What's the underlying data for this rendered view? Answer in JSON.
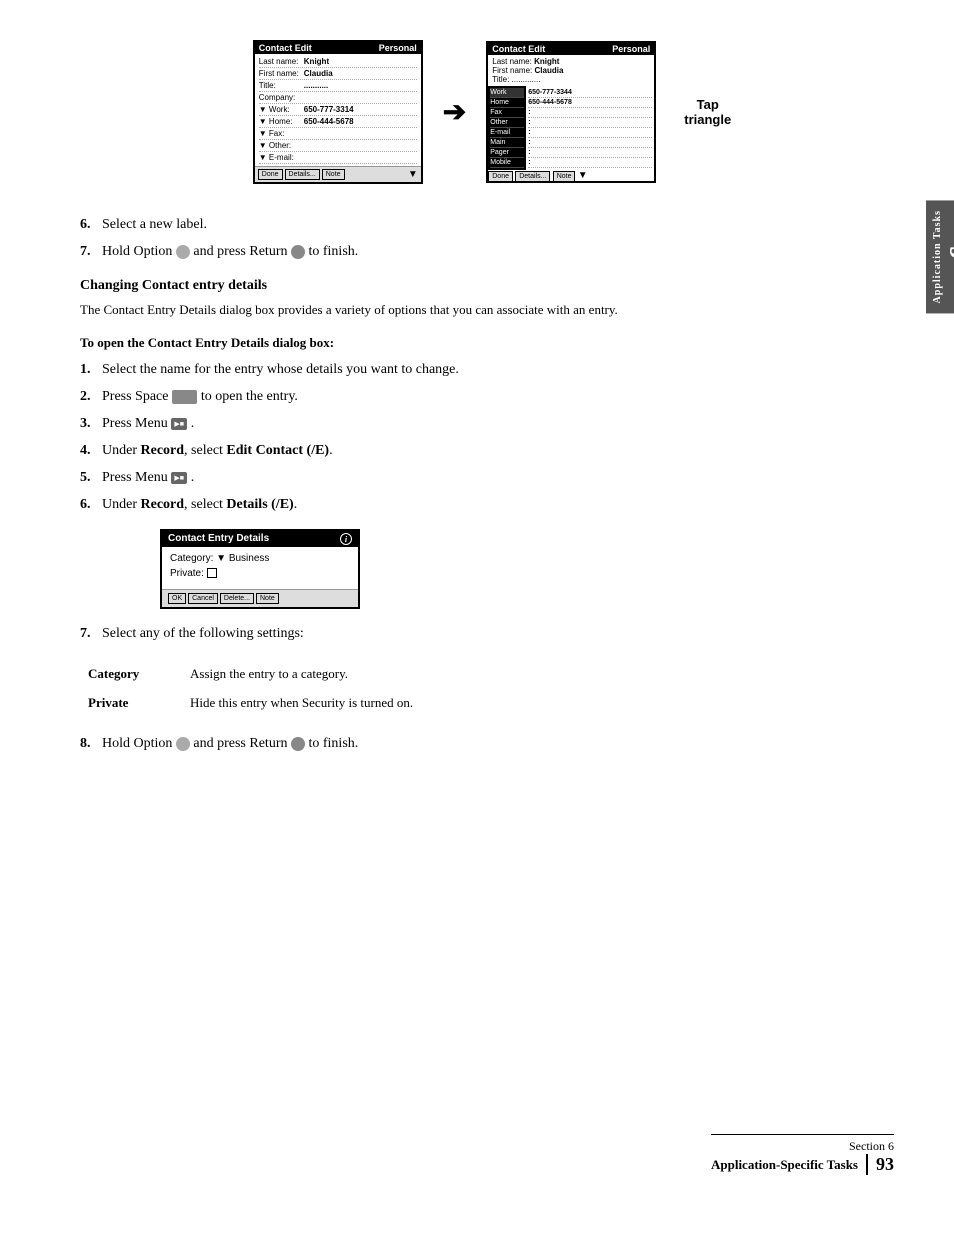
{
  "page": {
    "section_number": "6",
    "section_title": "Application Tasks",
    "sidebar_label": "Application Tasks"
  },
  "screen1": {
    "title": "Contact Edit",
    "tab": "Personal",
    "fields": [
      {
        "label": "Last name:",
        "value": "Knight",
        "bold": true
      },
      {
        "label": "First name:",
        "value": "Claudia",
        "bold": true
      },
      {
        "label": "Title:",
        "value": ""
      },
      {
        "label": "Company:",
        "value": ""
      },
      {
        "label": "▼ Work:",
        "value": "650-777-3314",
        "bold": true
      },
      {
        "label": "▼ Home:",
        "value": "650-444-5678",
        "bold": true
      },
      {
        "label": "▼ Fax:",
        "value": ""
      },
      {
        "label": "▼ Other:",
        "value": ""
      },
      {
        "label": "▼ E-mail:",
        "value": ""
      }
    ],
    "buttons": [
      "Done",
      "Details...",
      "Note"
    ]
  },
  "screen2": {
    "title": "Contact Edit",
    "tab": "Personal",
    "top_fields": [
      {
        "label": "Last name:",
        "value": "Knight"
      },
      {
        "label": "First name:",
        "value": "Claudia"
      },
      {
        "label": "Title:",
        "value": ""
      }
    ],
    "labels_col": [
      "Work",
      "Home",
      "Fax",
      "Other",
      "E-mail",
      "Main",
      "Pager",
      "Mobile"
    ],
    "values_col": [
      "650-777-3344",
      "650-444-5678",
      ":",
      ":",
      ":",
      ":",
      ":",
      ":"
    ],
    "buttons": [
      "Done",
      "Details...",
      "Note"
    ]
  },
  "tap_label": {
    "line1": "Tap",
    "line2": "triangle"
  },
  "steps_intro": {
    "step6": "Select a new label.",
    "step7_prefix": "Hold Option",
    "step7_suffix": "and press Return",
    "step7_end": "to finish."
  },
  "changing_contact": {
    "heading": "Changing Contact entry details",
    "body": "The Contact Entry Details dialog box provides a variety of options that you can associate with an entry."
  },
  "open_dialog": {
    "heading": "To open the Contact Entry Details dialog box:",
    "steps": [
      "Select the name for the entry whose details you want to change.",
      "Press Space        to open the entry.",
      "Press Menu         .",
      "Under Record, select Edit Contact (/E).",
      "Press Menu         .",
      "Under Record, select Details (/E)."
    ]
  },
  "details_box": {
    "title": "Contact Entry Details",
    "category_label": "Category:",
    "category_value": "Business",
    "private_label": "Private:",
    "buttons": [
      "OK",
      "Cancel",
      "Delete...",
      "Note"
    ]
  },
  "step7_after": {
    "text": "Select any of the following settings:"
  },
  "settings": [
    {
      "name": "Category",
      "description": "Assign the entry to a category."
    },
    {
      "name": "Private",
      "description": "Hide this entry when Security is turned on."
    }
  ],
  "step8": {
    "prefix": "Hold Option",
    "suffix": "and press Return",
    "end": "to finish."
  },
  "footer": {
    "section_text": "Section 6",
    "page_title": "Application-Specific Tasks",
    "page_num": "93"
  }
}
